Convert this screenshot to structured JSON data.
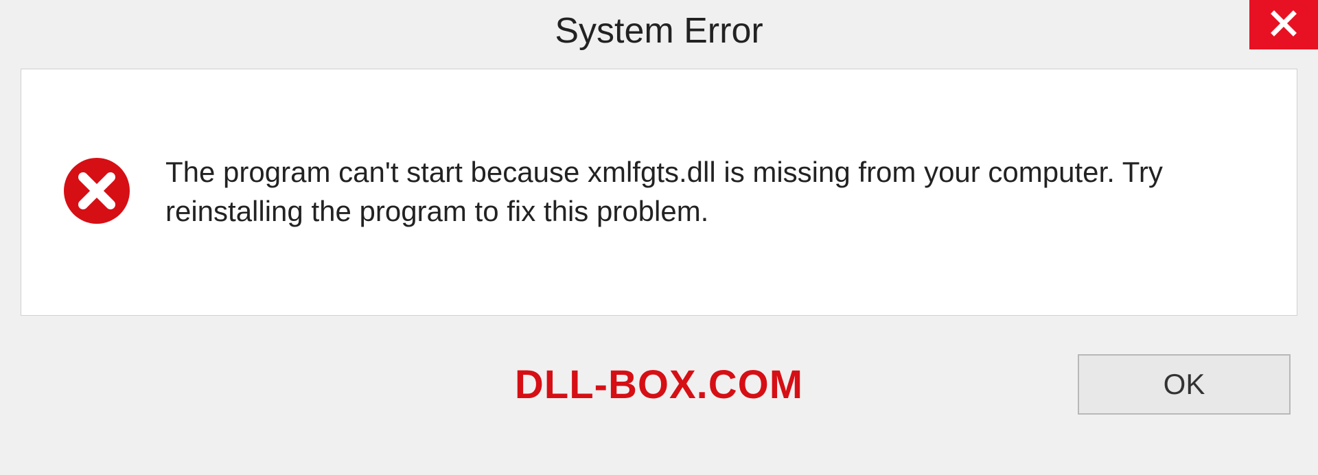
{
  "dialog": {
    "title": "System Error",
    "message": "The program can't start because xmlfgts.dll is missing from your computer. Try reinstalling the program to fix this problem.",
    "ok_label": "OK"
  },
  "watermark": "DLL-BOX.COM",
  "colors": {
    "close_bg": "#e81123",
    "error_icon": "#d60f15",
    "watermark": "#d60f15"
  }
}
